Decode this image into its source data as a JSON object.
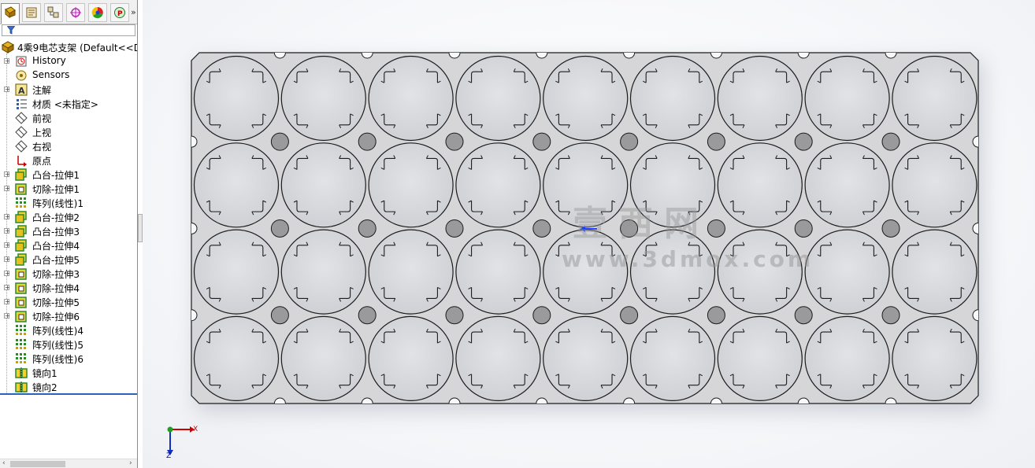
{
  "tabs": [
    {
      "name": "feature-manager",
      "icon": "feature-tree-icon"
    },
    {
      "name": "property-manager",
      "icon": "property-manager-icon"
    },
    {
      "name": "configuration-manager",
      "icon": "configuration-icon"
    },
    {
      "name": "dimxpert-manager",
      "icon": "dimxpert-icon"
    },
    {
      "name": "display-manager",
      "icon": "appearance-icon"
    },
    {
      "name": "plugin",
      "icon": "plugin-icon"
    }
  ],
  "tab_more": "»",
  "tree": {
    "root_label": "4乘9电芯支架  (Default<<D",
    "items": [
      {
        "label": "History",
        "icon": "history-icon",
        "expandable": true
      },
      {
        "label": "Sensors",
        "icon": "sensors-icon",
        "expandable": false
      },
      {
        "label": "注解",
        "icon": "annotations-icon",
        "expandable": true
      },
      {
        "label": "材质 <未指定>",
        "icon": "material-icon",
        "expandable": false
      },
      {
        "label": "前视",
        "icon": "plane-icon",
        "expandable": false
      },
      {
        "label": "上视",
        "icon": "plane-icon",
        "expandable": false
      },
      {
        "label": "右视",
        "icon": "plane-icon",
        "expandable": false
      },
      {
        "label": "原点",
        "icon": "origin-icon",
        "expandable": false
      },
      {
        "label": "凸台-拉伸1",
        "icon": "boss-extrude-icon",
        "expandable": true
      },
      {
        "label": "切除-拉伸1",
        "icon": "cut-extrude-icon",
        "expandable": true
      },
      {
        "label": "阵列(线性)1",
        "icon": "linear-pattern-icon",
        "expandable": false
      },
      {
        "label": "凸台-拉伸2",
        "icon": "boss-extrude-icon",
        "expandable": true
      },
      {
        "label": "凸台-拉伸3",
        "icon": "boss-extrude-icon",
        "expandable": true
      },
      {
        "label": "凸台-拉伸4",
        "icon": "boss-extrude-icon",
        "expandable": true
      },
      {
        "label": "凸台-拉伸5",
        "icon": "boss-extrude-icon",
        "expandable": true
      },
      {
        "label": "切除-拉伸3",
        "icon": "cut-extrude-icon",
        "expandable": true
      },
      {
        "label": "切除-拉伸4",
        "icon": "cut-extrude-icon",
        "expandable": true
      },
      {
        "label": "切除-拉伸5",
        "icon": "cut-extrude-icon",
        "expandable": true
      },
      {
        "label": "切除-拉伸6",
        "icon": "cut-extrude-icon",
        "expandable": true
      },
      {
        "label": "阵列(线性)4",
        "icon": "linear-pattern-icon",
        "expandable": false
      },
      {
        "label": "阵列(线性)5",
        "icon": "linear-pattern-icon",
        "expandable": false
      },
      {
        "label": "阵列(线性)6",
        "icon": "linear-pattern-icon",
        "expandable": false
      },
      {
        "label": "镜向1",
        "icon": "mirror-icon",
        "expandable": false
      },
      {
        "label": "镜向2",
        "icon": "mirror-icon",
        "expandable": false
      }
    ]
  },
  "model": {
    "description_rows": 4,
    "description_cols": 9,
    "plate_color": "#d6d6d8",
    "hole_color": "#9a9a9c",
    "edge_color": "#1c1c1c"
  },
  "watermark": {
    "title": "壹西网",
    "url": "www.3dmox.com"
  },
  "triad": {
    "x_label": "X",
    "z_label": "Z"
  },
  "colors": {
    "selection_blue": "#2b63b8",
    "origin_arrow": "#1e3cff"
  }
}
